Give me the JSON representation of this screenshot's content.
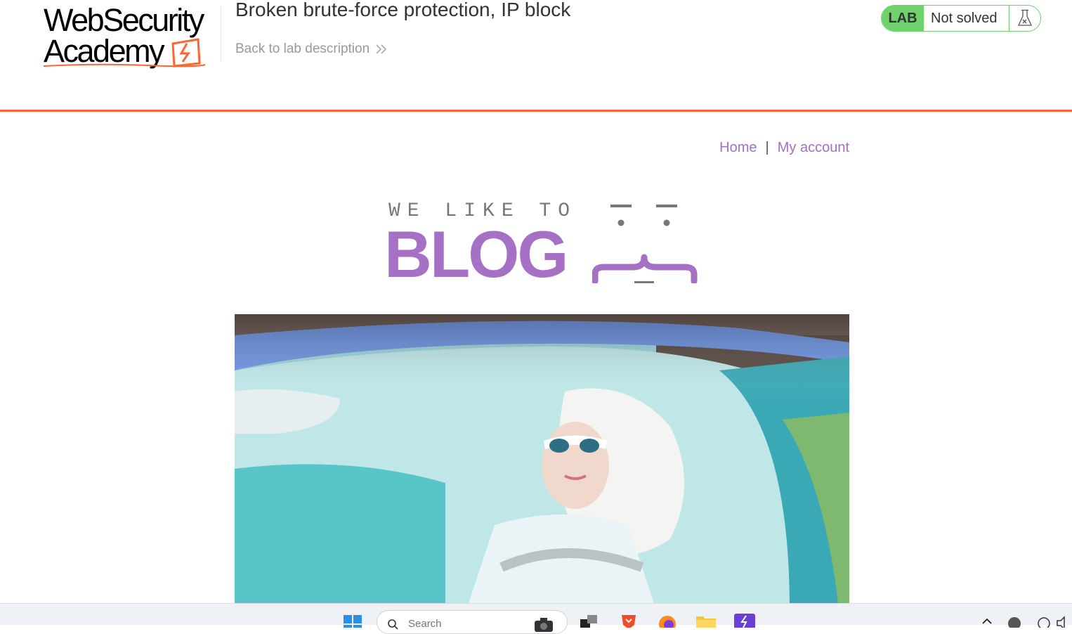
{
  "academy": {
    "logo_line1": "WebSecurity",
    "logo_line2": "Academy",
    "lab_title": "Broken brute-force protection, IP block",
    "back_link": "Back to lab description",
    "lab_badge": "LAB",
    "lab_status": "Not solved",
    "accent_color": "#ff6633",
    "status_color": "#70d16d"
  },
  "blog": {
    "nav": {
      "home": "Home",
      "separator": "|",
      "my_account": "My account"
    },
    "banner_top": "WE LIKE TO",
    "banner_main": "BLOG",
    "brand_color": "#a670c4"
  },
  "taskbar": {
    "search_placeholder": "Search",
    "icons": [
      "windows-start-icon",
      "search-icon",
      "camera-icon",
      "task-view-icon",
      "brave-browser-icon",
      "firefox-icon",
      "file-explorer-icon",
      "burp-suite-icon",
      "chevron-up-icon",
      "network-icon",
      "volume-icon"
    ]
  }
}
